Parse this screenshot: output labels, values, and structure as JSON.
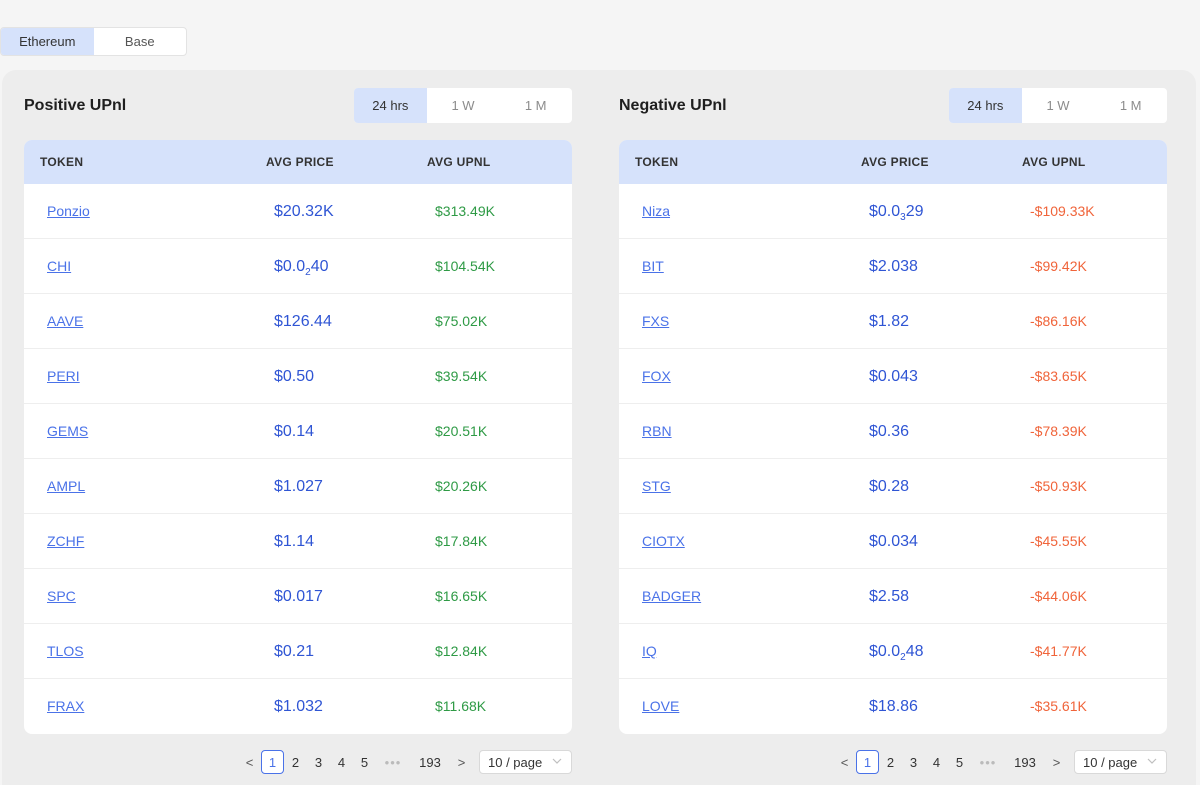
{
  "chain_tabs": [
    {
      "label": "Ethereum",
      "active": true
    },
    {
      "label": "Base",
      "active": false
    }
  ],
  "period_labels": [
    "24 hrs",
    "1 W",
    "1 M"
  ],
  "columns": {
    "token": "TOKEN",
    "price": "AVG PRICE",
    "upnl": "AVG UPNL"
  },
  "positive": {
    "title": "Positive UPnl",
    "rows": [
      {
        "token": "Ponzio",
        "price": "$20.32K",
        "upnl": "$313.49K"
      },
      {
        "token": "CHI",
        "price": "$0.0",
        "price_sub": "2",
        "price_tail": "40",
        "upnl": "$104.54K"
      },
      {
        "token": "AAVE",
        "price": "$126.44",
        "upnl": "$75.02K"
      },
      {
        "token": "PERI",
        "price": "$0.50",
        "upnl": "$39.54K"
      },
      {
        "token": "GEMS",
        "price": "$0.14",
        "upnl": "$20.51K"
      },
      {
        "token": "AMPL",
        "price": "$1.027",
        "upnl": "$20.26K"
      },
      {
        "token": "ZCHF",
        "price": "$1.14",
        "upnl": "$17.84K"
      },
      {
        "token": "SPC",
        "price": "$0.017",
        "upnl": "$16.65K"
      },
      {
        "token": "TLOS",
        "price": "$0.21",
        "upnl": "$12.84K"
      },
      {
        "token": "FRAX",
        "price": "$1.032",
        "upnl": "$11.68K"
      }
    ]
  },
  "negative": {
    "title": "Negative UPnl",
    "rows": [
      {
        "token": "Niza",
        "price": "$0.0",
        "price_sub": "3",
        "price_tail": "29",
        "upnl": "-$109.33K"
      },
      {
        "token": "BIT",
        "price": "$2.038",
        "upnl": "-$99.42K"
      },
      {
        "token": "FXS",
        "price": "$1.82",
        "upnl": "-$86.16K"
      },
      {
        "token": "FOX",
        "price": "$0.043",
        "upnl": "-$83.65K"
      },
      {
        "token": "RBN",
        "price": "$0.36",
        "upnl": "-$78.39K"
      },
      {
        "token": "STG",
        "price": "$0.28",
        "upnl": "-$50.93K"
      },
      {
        "token": "CIOTX",
        "price": "$0.034",
        "upnl": "-$45.55K"
      },
      {
        "token": "BADGER",
        "price": "$2.58",
        "upnl": "-$44.06K"
      },
      {
        "token": "IQ",
        "price": "$0.0",
        "price_sub": "2",
        "price_tail": "48",
        "upnl": "-$41.77K"
      },
      {
        "token": "LOVE",
        "price": "$18.86",
        "upnl": "-$35.61K"
      }
    ]
  },
  "pagination": {
    "prev": "<",
    "next": ">",
    "pages": [
      "1",
      "2",
      "3",
      "4",
      "5"
    ],
    "current": "1",
    "ellipsis": "•••",
    "last": "193",
    "page_size": "10 / page"
  },
  "colors": {
    "accent": "#4a72e8",
    "positive": "#2e9a45",
    "negative": "#f0643a",
    "header_bg": "#d6e2fb"
  }
}
